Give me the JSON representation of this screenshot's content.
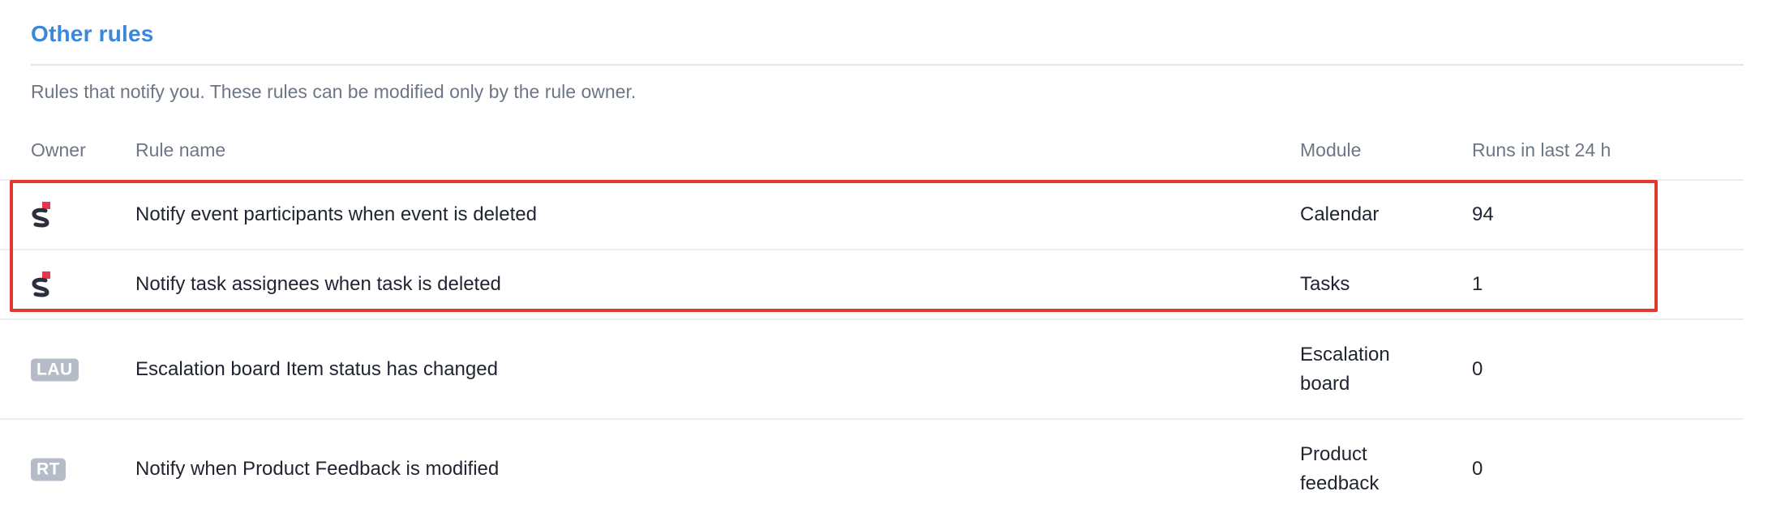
{
  "section": {
    "title": "Other rules",
    "description": "Rules that notify you. These rules can be modified only by the rule owner."
  },
  "table": {
    "headers": {
      "owner": "Owner",
      "rule_name": "Rule name",
      "module": "Module",
      "runs": "Runs in last 24 h"
    },
    "rows": [
      {
        "owner_type": "app-logo-icon",
        "owner": "",
        "rule_name": "Notify event participants when event is deleted",
        "module": "Calendar",
        "runs": "94"
      },
      {
        "owner_type": "app-logo-icon",
        "owner": "",
        "rule_name": "Notify task assignees when task is deleted",
        "module": "Tasks",
        "runs": "1"
      },
      {
        "owner_type": "initials-badge",
        "owner": "LAU",
        "rule_name": "Escalation board Item status has changed",
        "module": "Escalation board",
        "runs": "0"
      },
      {
        "owner_type": "initials-badge",
        "owner": "RT",
        "rule_name": "Notify when Product Feedback is modified",
        "module": "Product feedback",
        "runs": "0"
      }
    ]
  },
  "colors": {
    "title": "#3b87d9",
    "highlight": "#e2392c",
    "badge": "#b5bcc7",
    "logo_accent": "#e8384f",
    "logo_dark": "#2b2f3b"
  }
}
